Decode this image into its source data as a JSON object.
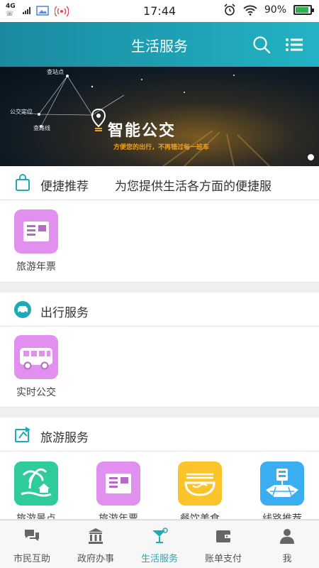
{
  "status_bar": {
    "network_top": "4G",
    "network_bottom": "",
    "time": "17:44",
    "battery_text": "90%",
    "battery_level": 0.9
  },
  "header": {
    "title": "生活服务",
    "icons": [
      "search-icon",
      "list-menu-icon"
    ]
  },
  "banner": {
    "labels": [
      "查站点",
      "公交定位",
      "查路线"
    ],
    "headline": "智能公交",
    "subline": "方便您的出行，不再错过每一班车",
    "active_slide": 1,
    "colors": {
      "accent": "#f0a020"
    }
  },
  "sections": [
    {
      "name": "便捷推荐",
      "desc": "为您提供生活各方面的便捷服",
      "icon": "shopping-bag-icon",
      "items": [
        {
          "label": "旅游年票",
          "icon": "ticket-card-icon",
          "color": "#e190ef"
        }
      ]
    },
    {
      "name": "出行服务",
      "desc": "",
      "icon": "car-icon",
      "items": [
        {
          "label": "实时公交",
          "icon": "bus-icon",
          "color": "#e190ef"
        }
      ]
    },
    {
      "name": "旅游服务",
      "desc": "",
      "icon": "travel-sign-icon",
      "items": [
        {
          "label": "旅游景点",
          "icon": "island-icon",
          "color": "#2fcb9c"
        },
        {
          "label": "旅游年票",
          "icon": "ticket-card-icon",
          "color": "#e190ef"
        },
        {
          "label": "餐饮美食",
          "icon": "noodle-bowl-icon",
          "color": "#fbc42a"
        },
        {
          "label": "线路推荐",
          "icon": "route-map-icon",
          "color": "#3aaef0"
        }
      ]
    }
  ],
  "bottom_nav": [
    {
      "label": "市民互助",
      "icon": "chat-bubbles-icon"
    },
    {
      "label": "政府办事",
      "icon": "government-building-icon"
    },
    {
      "label": "生活服务",
      "icon": "cocktail-icon",
      "active": true
    },
    {
      "label": "账单支付",
      "icon": "wallet-icon"
    },
    {
      "label": "我",
      "icon": "person-icon"
    }
  ],
  "colors": {
    "brand": "#1eaab7",
    "active_tab": "#1eaab7"
  }
}
